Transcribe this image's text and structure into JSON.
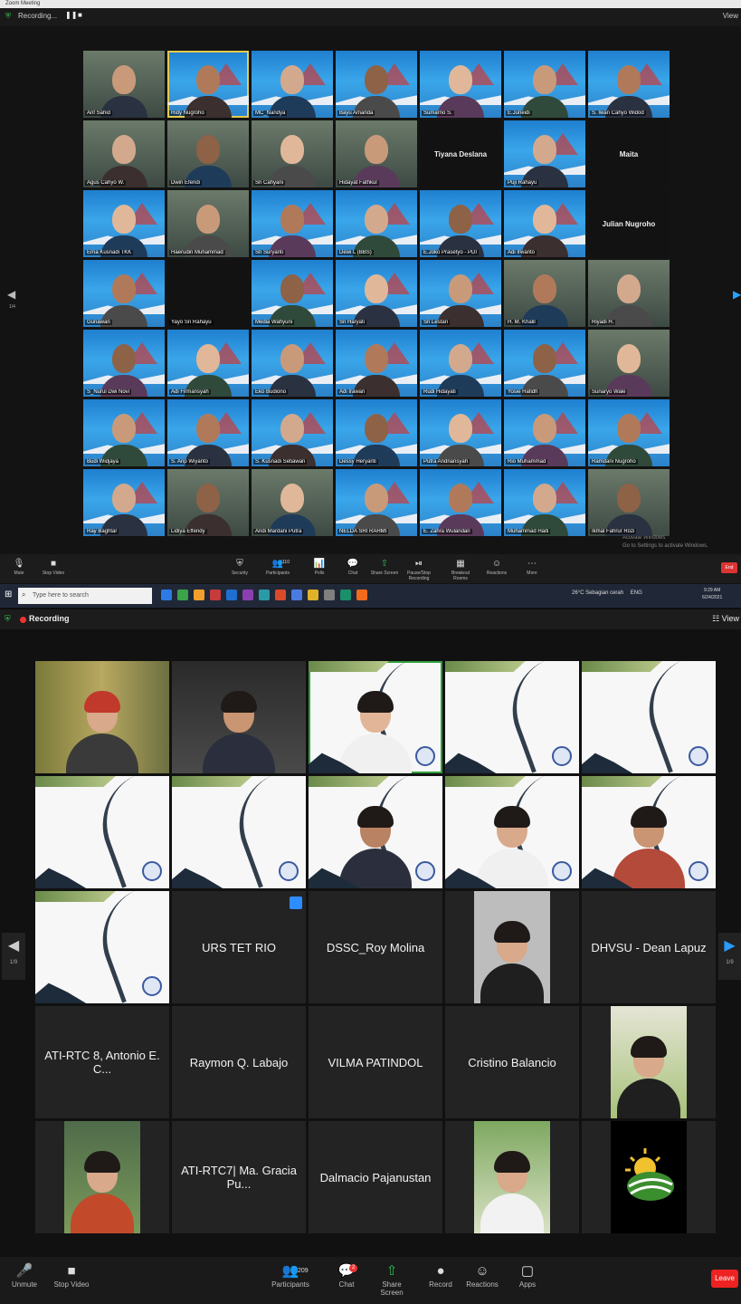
{
  "top": {
    "title": "Zoom Meeting",
    "recording_label": "Recording...",
    "view_label": "View",
    "page_indicator": "1/4",
    "tiles": [
      {
        "name": "Arif Sahid",
        "kind": "cam"
      },
      {
        "name": "Ridy Nugroho",
        "kind": "banner",
        "selected": true
      },
      {
        "name": "MC_Nandya",
        "kind": "banner"
      },
      {
        "name": "Bayu Amanda",
        "kind": "banner"
      },
      {
        "name": "Sumarno S.",
        "kind": "banner"
      },
      {
        "name": "E.Juneidi",
        "kind": "banner"
      },
      {
        "name": "S. Iwan Cahyo Widod",
        "kind": "banner"
      },
      {
        "name": "Agus Cahyo W.",
        "kind": "cam"
      },
      {
        "name": "Dwin Efendi",
        "kind": "cam"
      },
      {
        "name": "Sri Cahyani",
        "kind": "cam"
      },
      {
        "name": "Hidayat Fathkul",
        "kind": "cam"
      },
      {
        "name": "",
        "kind": "black",
        "center": "Tiyana Deslana"
      },
      {
        "name": "Puji Rahayu",
        "kind": "banner"
      },
      {
        "name": "",
        "kind": "black",
        "center": "Maita"
      },
      {
        "name": "Erna Kusnadi TKK",
        "kind": "banner"
      },
      {
        "name": "Haerudin Muhammad",
        "kind": "cam"
      },
      {
        "name": "Sri Suryanti",
        "kind": "banner"
      },
      {
        "name": "Dewi L (BBS)",
        "kind": "banner"
      },
      {
        "name": "E.Joko Prasetyo - PDI",
        "kind": "banner"
      },
      {
        "name": "Adi Irwanto",
        "kind": "banner"
      },
      {
        "name": "",
        "kind": "black",
        "center": "Julian Nugroho"
      },
      {
        "name": "Gunawan",
        "kind": "banner"
      },
      {
        "name": "Yayo Sri Rahayu",
        "kind": "black"
      },
      {
        "name": "Media Wahyuni",
        "kind": "banner"
      },
      {
        "name": "Sri Haryati",
        "kind": "banner"
      },
      {
        "name": "Sri Lestari",
        "kind": "banner"
      },
      {
        "name": "H. M. Khalil",
        "kind": "cam"
      },
      {
        "name": "Riyadi H.",
        "kind": "cam"
      },
      {
        "name": "S_Nurul Dwi Novi",
        "kind": "banner"
      },
      {
        "name": "Adi Firmansyah",
        "kind": "banner"
      },
      {
        "name": "Eko Budiono",
        "kind": "banner"
      },
      {
        "name": "Adi Irawan",
        "kind": "banner"
      },
      {
        "name": "Rudi Hidayati",
        "kind": "banner"
      },
      {
        "name": "Yosie Hafidh",
        "kind": "banner"
      },
      {
        "name": "Sunaryo Wale",
        "kind": "cam"
      },
      {
        "name": "Budi Widjaya",
        "kind": "banner"
      },
      {
        "name": "S. Arip Wiyanto",
        "kind": "banner"
      },
      {
        "name": "S. Kusnadi Setiawan",
        "kind": "banner"
      },
      {
        "name": "Dessy Heryanti",
        "kind": "banner"
      },
      {
        "name": "Putra Andriansyah",
        "kind": "banner"
      },
      {
        "name": "Rio Muhammad",
        "kind": "banner"
      },
      {
        "name": "Ramdani Nugroho",
        "kind": "banner"
      },
      {
        "name": "Ray Baghtar",
        "kind": "banner"
      },
      {
        "name": "Lidiya Effendy",
        "kind": "cam"
      },
      {
        "name": "Andi Mardani Putra",
        "kind": "cam"
      },
      {
        "name": "NELDA SRI RAHMI",
        "kind": "banner"
      },
      {
        "name": "E. Zahra Wulandari",
        "kind": "banner"
      },
      {
        "name": "Muhammad Haiti",
        "kind": "banner"
      },
      {
        "name": "Ikmal Fahrur Rozi",
        "kind": "cam"
      }
    ],
    "toolbar": [
      {
        "icon": "🎙",
        "label": "Mute"
      },
      {
        "icon": "■",
        "label": "Stop Video"
      },
      {
        "icon": "⛨",
        "label": "Security"
      },
      {
        "icon": "👥",
        "label": "Participants",
        "count": "110"
      },
      {
        "icon": "📊",
        "label": "Polls"
      },
      {
        "icon": "💬",
        "label": "Chat"
      },
      {
        "icon": "⇧",
        "label": "Share Screen"
      },
      {
        "icon": "⏯",
        "label": "Pause/Stop Recording"
      },
      {
        "icon": "▦",
        "label": "Breakout Rooms"
      },
      {
        "icon": "☺",
        "label": "Reactions"
      },
      {
        "icon": "⋯",
        "label": "More"
      }
    ],
    "end_label": "End",
    "activate_windows": [
      "Activate Windows",
      "Go to Settings to activate Windows."
    ]
  },
  "taskbar": {
    "search_placeholder": "Type here to search",
    "weather": "26°C  Sebagian cerah",
    "lang": "ENG",
    "time": "9:29 AM",
    "date": "6/24/2021",
    "icons": [
      "#2c7be5",
      "#3aa34a",
      "#f0a02b",
      "#c63b3b",
      "#1f6fd1",
      "#8b3fb0",
      "#2b9aa8",
      "#d84a2a",
      "#4a7be0",
      "#e0b229",
      "#7f7f7f",
      "#1b8f6a",
      "#f26b1d"
    ]
  },
  "bottom": {
    "recording_label": "Recording",
    "view_label": "View",
    "page_indicator": "1/9",
    "tiles": [
      {
        "kind": "person",
        "name": ""
      },
      {
        "kind": "person",
        "name": ""
      },
      {
        "kind": "slide-person",
        "name": "",
        "active": true
      },
      {
        "kind": "slide",
        "name": ""
      },
      {
        "kind": "slide",
        "name": ""
      },
      {
        "kind": "slide",
        "name": ""
      },
      {
        "kind": "slide",
        "name": ""
      },
      {
        "kind": "slide-person",
        "name": ""
      },
      {
        "kind": "slide-person",
        "name": ""
      },
      {
        "kind": "slide-person",
        "name": ""
      },
      {
        "kind": "slide",
        "name": ""
      },
      {
        "kind": "label",
        "name": "URS TET RIO"
      },
      {
        "kind": "label",
        "name": "DSSC_Roy Molina"
      },
      {
        "kind": "photo",
        "name": ""
      },
      {
        "kind": "label",
        "name": "DHVSU - Dean Lapuz"
      },
      {
        "kind": "label",
        "name": "ATI-RTC 8, Antonio E. C..."
      },
      {
        "kind": "label",
        "name": "Raymon Q. Labajo"
      },
      {
        "kind": "label",
        "name": "VILMA PATINDOL"
      },
      {
        "kind": "label",
        "name": "Cristino Balancio"
      },
      {
        "kind": "photo",
        "name": ""
      },
      {
        "kind": "photo",
        "name": ""
      },
      {
        "kind": "label",
        "name": "ATI-RTC7| Ma. Gracia Pu..."
      },
      {
        "kind": "label",
        "name": "Dalmacio Pajanustan"
      },
      {
        "kind": "photo",
        "name": ""
      },
      {
        "kind": "logo",
        "name": ""
      }
    ],
    "toolbar": [
      {
        "icon": "🎤",
        "label": "Unmute"
      },
      {
        "icon": "■",
        "label": "Stop Video"
      },
      {
        "icon": "👥",
        "label": "Participants",
        "count": "209"
      },
      {
        "icon": "💬",
        "label": "Chat",
        "badge": "2"
      },
      {
        "icon": "⇧",
        "label": "Share Screen"
      },
      {
        "icon": "●",
        "label": "Record"
      },
      {
        "icon": "☺",
        "label": "Reactions"
      },
      {
        "icon": "▢",
        "label": "Apps"
      }
    ],
    "leave_label": "Leave"
  }
}
